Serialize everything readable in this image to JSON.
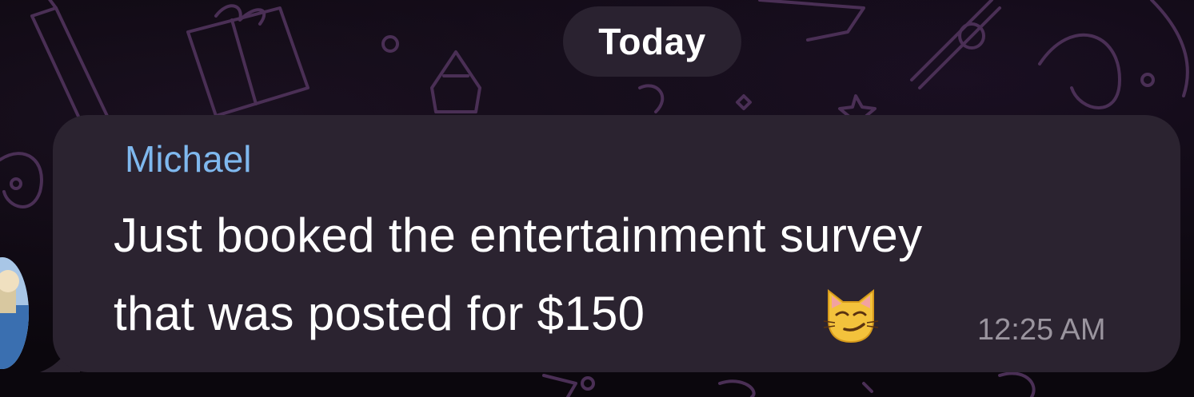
{
  "chat": {
    "date_separator": "Today",
    "message": {
      "sender": "Michael",
      "text_line1": "Just booked the entertainment survey",
      "text_line2": "that was posted for $150",
      "emoji": "smirking-cat-emoji",
      "timestamp": "12:25 AM"
    }
  },
  "colors": {
    "background": "#0b070d",
    "bubble": "#2b2330",
    "date_pill": "#2a2230",
    "sender_name": "#7fb8ee",
    "timestamp": "#9a949e",
    "message_text": "#ffffff"
  }
}
